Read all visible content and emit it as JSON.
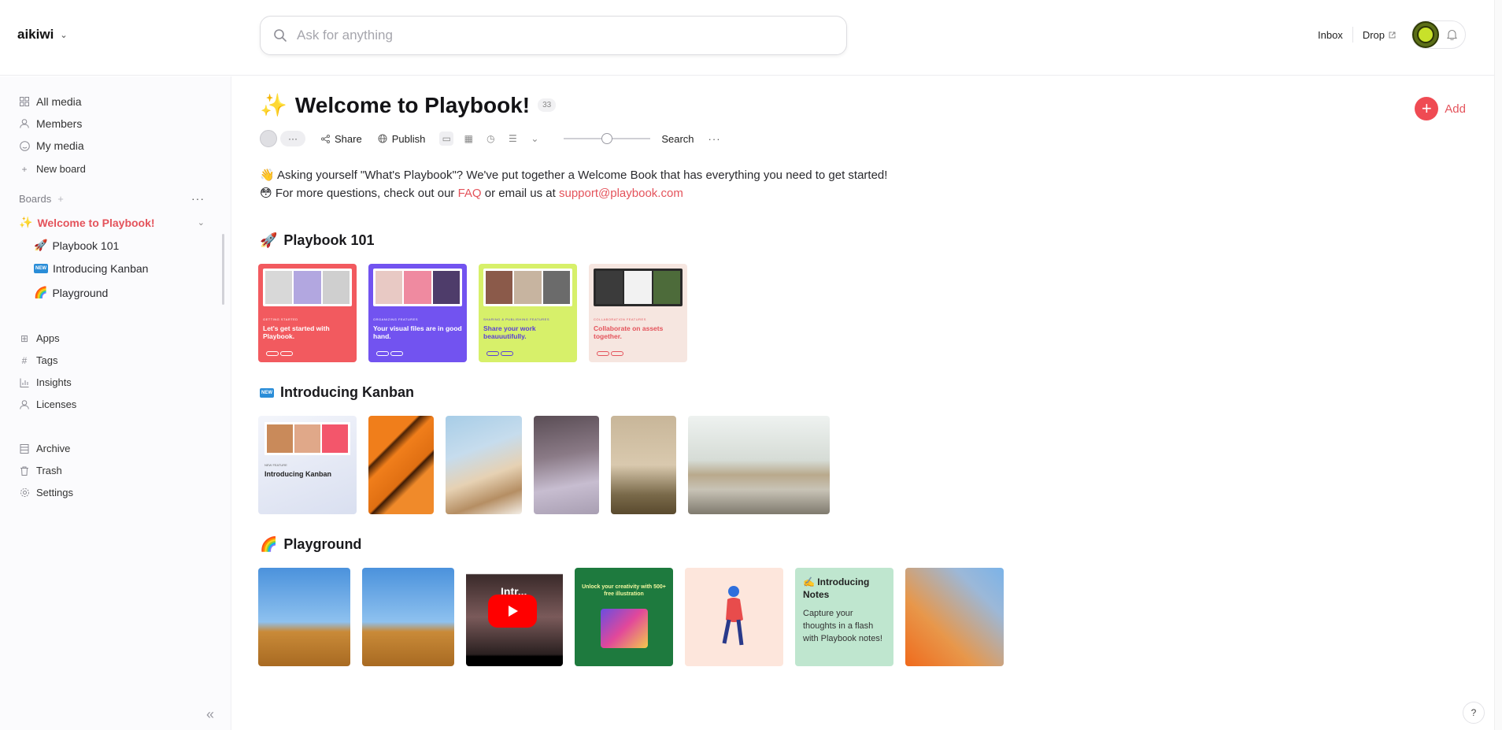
{
  "workspace": {
    "name": "aikiwi"
  },
  "search": {
    "placeholder": "Ask for anything"
  },
  "header": {
    "inbox": "Inbox",
    "drop": "Drop"
  },
  "sidebar": {
    "nav": [
      {
        "label": "All media",
        "icon": "grid-icon"
      },
      {
        "label": "Members",
        "icon": "user-icon"
      },
      {
        "label": "My media",
        "icon": "smile-icon"
      },
      {
        "label": "New board",
        "icon": "plus-icon"
      }
    ],
    "boards_label": "Boards",
    "active_board": {
      "emoji": "✨",
      "label": "Welcome to Playbook!"
    },
    "sub_boards": [
      {
        "emoji": "🚀",
        "label": "Playbook 101"
      },
      {
        "emoji": "🆕",
        "label": "Introducing Kanban"
      },
      {
        "emoji": "🌈",
        "label": "Playground"
      }
    ],
    "secondary": [
      {
        "label": "Apps",
        "icon": "apps-icon"
      },
      {
        "label": "Tags",
        "icon": "hash-icon"
      },
      {
        "label": "Insights",
        "icon": "chart-icon"
      },
      {
        "label": "Licenses",
        "icon": "person-icon"
      }
    ],
    "tertiary": [
      {
        "label": "Archive",
        "icon": "archive-icon"
      },
      {
        "label": "Trash",
        "icon": "trash-icon"
      },
      {
        "label": "Settings",
        "icon": "gear-icon"
      }
    ]
  },
  "board": {
    "emoji": "✨",
    "title": "Welcome to Playbook!",
    "count": "33",
    "add_label": "Add",
    "toolbar": {
      "share": "Share",
      "publish": "Publish",
      "search": "Search"
    },
    "desc": {
      "line1_emoji": "👋",
      "line1": "Asking yourself \"What's Playbook\"? We've put together a Welcome Book that has everything you need to get started!",
      "line2_emoji": "😳",
      "line2_pre": "For more questions, check out our",
      "faq": "FAQ",
      "line2_mid": "or email us at",
      "email": "support@playbook.com"
    }
  },
  "sections": {
    "playbook101": {
      "emoji": "🚀",
      "title": "Playbook 101",
      "cards": [
        {
          "label": "GETTING STARTED",
          "headline": "Let's get started with Playbook.",
          "bg": "#f25a5f",
          "fg": "#ffffff"
        },
        {
          "label": "ORGANIZING FEATURES",
          "headline": "Your visual files are in good hand.",
          "bg": "#7253f0",
          "fg": "#ffffff"
        },
        {
          "label": "SHARING & PUBLISHING FEATURES",
          "headline": "Share your work beauuutifully.",
          "bg": "#d7f06a",
          "fg": "#5a3fd6"
        },
        {
          "label": "COLLABORATION FEATURES",
          "headline": "Collaborate on assets together.",
          "bg": "#f6e6e0",
          "fg": "#e4535b"
        }
      ]
    },
    "kanban": {
      "badge": "NEW",
      "title": "Introducing Kanban",
      "card_label": "NEW FEATURE",
      "card_headline": "Introducing Kanban"
    },
    "playground": {
      "emoji": "🌈",
      "title": "Playground",
      "yt_title": "Intr...",
      "green_text": "Unlock your creativity with 500+ free illustration",
      "note": {
        "emoji": "✍️",
        "title": "Introducing Notes",
        "body": "Capture your thoughts in a flash with Playbook notes!"
      }
    }
  },
  "colors": {
    "accent": "#e4535b",
    "add": "#ef4b53"
  }
}
